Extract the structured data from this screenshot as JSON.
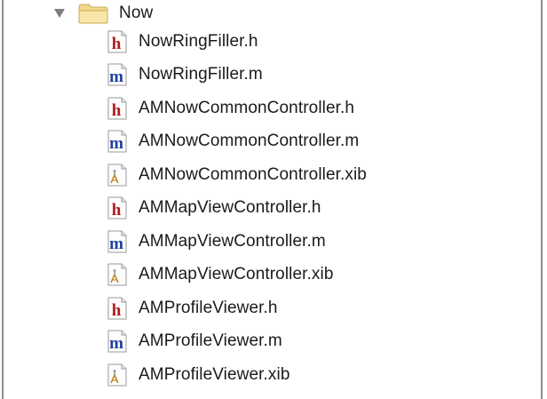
{
  "group": {
    "label": "Now",
    "expanded": true,
    "disclosure_icon": "disclosure-triangle-down-icon",
    "folder_icon": "folder-icon",
    "folder_color": "#f3d98c"
  },
  "files": [
    {
      "name": "NowRingFiller.h",
      "type": "h"
    },
    {
      "name": "NowRingFiller.m",
      "type": "m"
    },
    {
      "name": "AMNowCommonController.h",
      "type": "h"
    },
    {
      "name": "AMNowCommonController.m",
      "type": "m"
    },
    {
      "name": "AMNowCommonController.xib",
      "type": "xib"
    },
    {
      "name": "AMMapViewController.h",
      "type": "h"
    },
    {
      "name": "AMMapViewController.m",
      "type": "m"
    },
    {
      "name": "AMMapViewController.xib",
      "type": "xib"
    },
    {
      "name": "AMProfileViewer.h",
      "type": "h"
    },
    {
      "name": "AMProfileViewer.m",
      "type": "m"
    },
    {
      "name": "AMProfileViewer.xib",
      "type": "xib"
    }
  ],
  "icon_glyphs": {
    "h": "h",
    "m": "m"
  },
  "colors": {
    "header_letter": "#b3181e",
    "implementation_letter": "#1e3f9e"
  }
}
